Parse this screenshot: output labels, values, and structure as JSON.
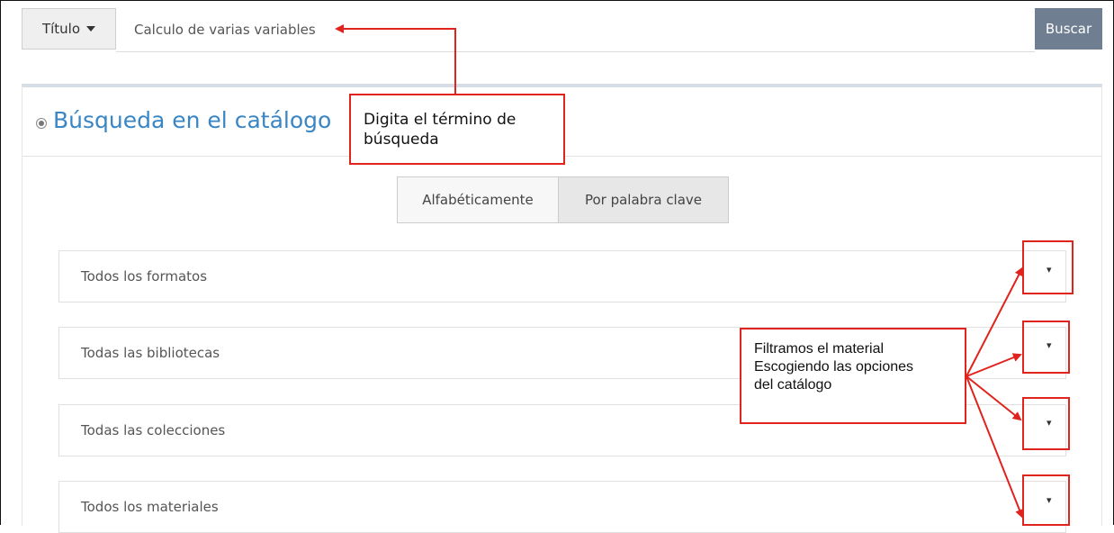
{
  "search": {
    "field_label": "Título",
    "query": "Calculo de varias variables",
    "button_label": "Buscar"
  },
  "panel": {
    "title": "Búsqueda en el catálogo",
    "toggle": {
      "alphabetical": "Alfabéticamente",
      "keyword": "Por palabra clave"
    },
    "filters": [
      {
        "label": "Todos los formatos"
      },
      {
        "label": "Todas las bibliotecas"
      },
      {
        "label": "Todas las colecciones"
      },
      {
        "label": "Todos los materiales"
      }
    ],
    "dropdown_glyph": "▾"
  },
  "annotations": {
    "callout_search": "Digita el término de búsqueda",
    "callout_filters": "Filtramos el material Escogiendo las opciones del catálogo",
    "annotation_color": "#e0231c"
  }
}
